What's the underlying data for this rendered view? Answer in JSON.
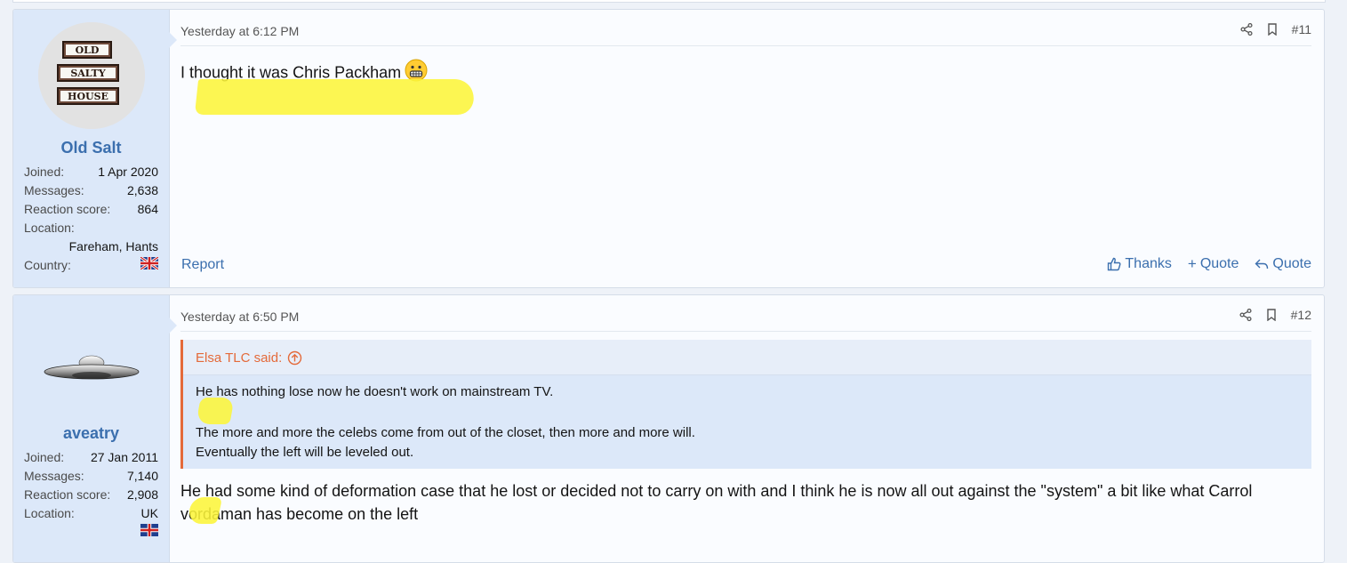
{
  "posts": [
    {
      "username": "Old Salt",
      "avatar_text": [
        "OLD",
        "SALTY",
        "HOUSE"
      ],
      "stats": {
        "joined_label": "Joined:",
        "joined": "1 Apr 2020",
        "messages_label": "Messages:",
        "messages": "2,638",
        "reaction_label": "Reaction score:",
        "reaction": "864",
        "location_label": "Location:",
        "location": "Fareham, Hants",
        "country_label": "Country:",
        "country_flag": "uk-flag-icon"
      },
      "date": "Yesterday at 6:12 PM",
      "number": "#11",
      "text": "I thought it was Chris Packham",
      "emoji": "grimacing-emoji",
      "report": "Report",
      "thanks": "Thanks",
      "multiquote": "Quote",
      "quote": "Quote"
    },
    {
      "username": "aveatry",
      "avatar": "ufo-icon",
      "stats": {
        "joined_label": "Joined:",
        "joined": "27 Jan 2011",
        "messages_label": "Messages:",
        "messages": "7,140",
        "reaction_label": "Reaction score:",
        "reaction": "2,908",
        "location_label": "Location:",
        "location": "UK"
      },
      "date": "Yesterday at 6:50 PM",
      "number": "#12",
      "quote_author": "Elsa TLC said:",
      "quote_lines": [
        "He has nothing lose now he doesn't work on mainstream TV.",
        "The more and more the celebs come from out of the closet, then more and more will.",
        "Eventually the left will be leveled out."
      ],
      "text_line1": "He had some kind of deformation case that he lost or decided not to carry on with and I think he is now all out against the \"system\" a bit like what Carrol",
      "text_line2": "vordaman has become on the left"
    }
  ],
  "colors": {
    "accent": "#3b6fae",
    "quote_accent": "#e46a3a",
    "highlight": "#fcf53a"
  }
}
